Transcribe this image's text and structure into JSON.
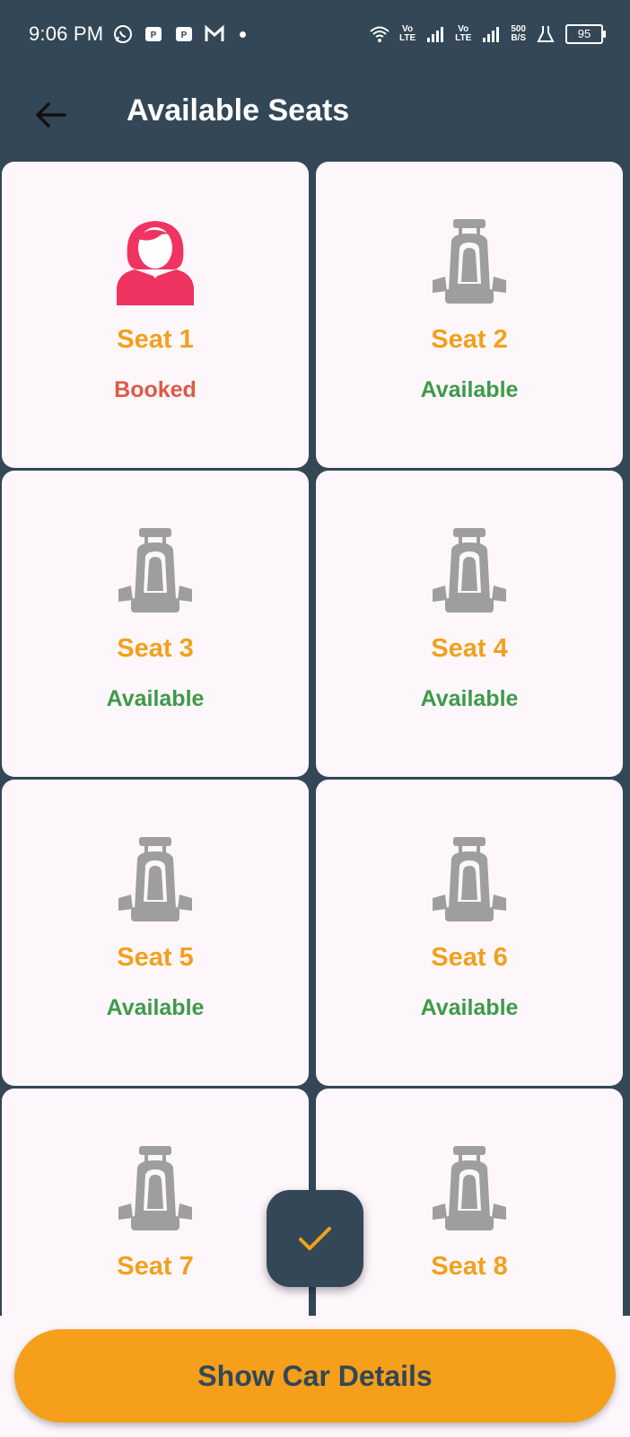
{
  "status_bar": {
    "time": "9:06 PM",
    "net_speed_top": "500",
    "net_speed_bottom": "B/S",
    "lte1_top": "Vo",
    "lte1_bottom": "LTE",
    "lte2_top": "Vo",
    "lte2_bottom": "LTE",
    "battery": "95"
  },
  "app_bar": {
    "title": "Available Seats"
  },
  "seats": [
    {
      "name": "Seat 1",
      "status": "Booked",
      "kind": "person"
    },
    {
      "name": "Seat 2",
      "status": "Available",
      "kind": "seat"
    },
    {
      "name": "Seat 3",
      "status": "Available",
      "kind": "seat"
    },
    {
      "name": "Seat 4",
      "status": "Available",
      "kind": "seat"
    },
    {
      "name": "Seat 5",
      "status": "Available",
      "kind": "seat"
    },
    {
      "name": "Seat 6",
      "status": "Available",
      "kind": "seat"
    },
    {
      "name": "Seat 7",
      "status": "",
      "kind": "seat"
    },
    {
      "name": "Seat 8",
      "status": "",
      "kind": "seat"
    }
  ],
  "colors": {
    "primary": "#334756",
    "accent": "#f59f1a",
    "booked": "#dd5a45",
    "available": "#3f9a49",
    "seat_icon": "#9e9e9e",
    "person_icon": "#ef3461"
  },
  "main_button": {
    "label": "Show Car Details"
  }
}
